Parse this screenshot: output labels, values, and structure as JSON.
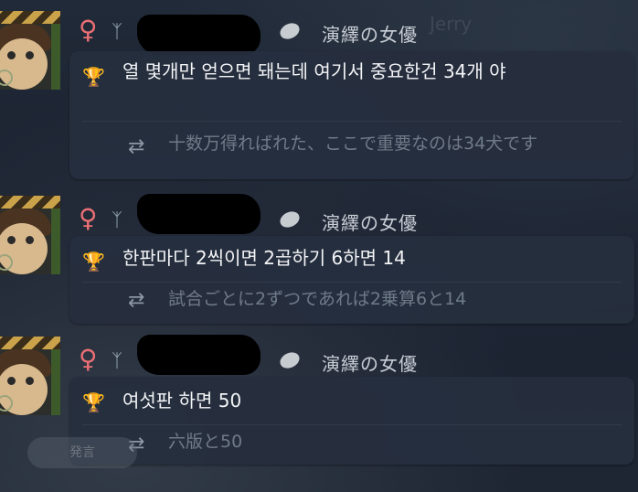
{
  "watermark": "Jerry",
  "background_button": "発言",
  "icons": {
    "female": "♀",
    "antler": "ᛉ",
    "trophy": "🏆",
    "translate": "⇄",
    "role_pill": "pill-icon"
  },
  "messages": [
    {
      "role": "演繹の女優",
      "text": "열 몇개만 얻으면 돼는데 여기서 중요한건 34개 야",
      "translation": "十数万得ればれた、ここで重要なのは34犬です"
    },
    {
      "role": "演繹の女優",
      "text": "한판마다 2씩이면 2곱하기 6하면 14",
      "translation": "試合ごとに2ずつであれば2乗算6と14"
    },
    {
      "role": "演繹の女優",
      "text": "여섯판 하면 50",
      "translation": "六版と50"
    }
  ],
  "colors": {
    "female": "#e96f74",
    "trophy": "#e07a32",
    "role_text": "#c9ced6",
    "translation_text": "#6f7a88"
  }
}
